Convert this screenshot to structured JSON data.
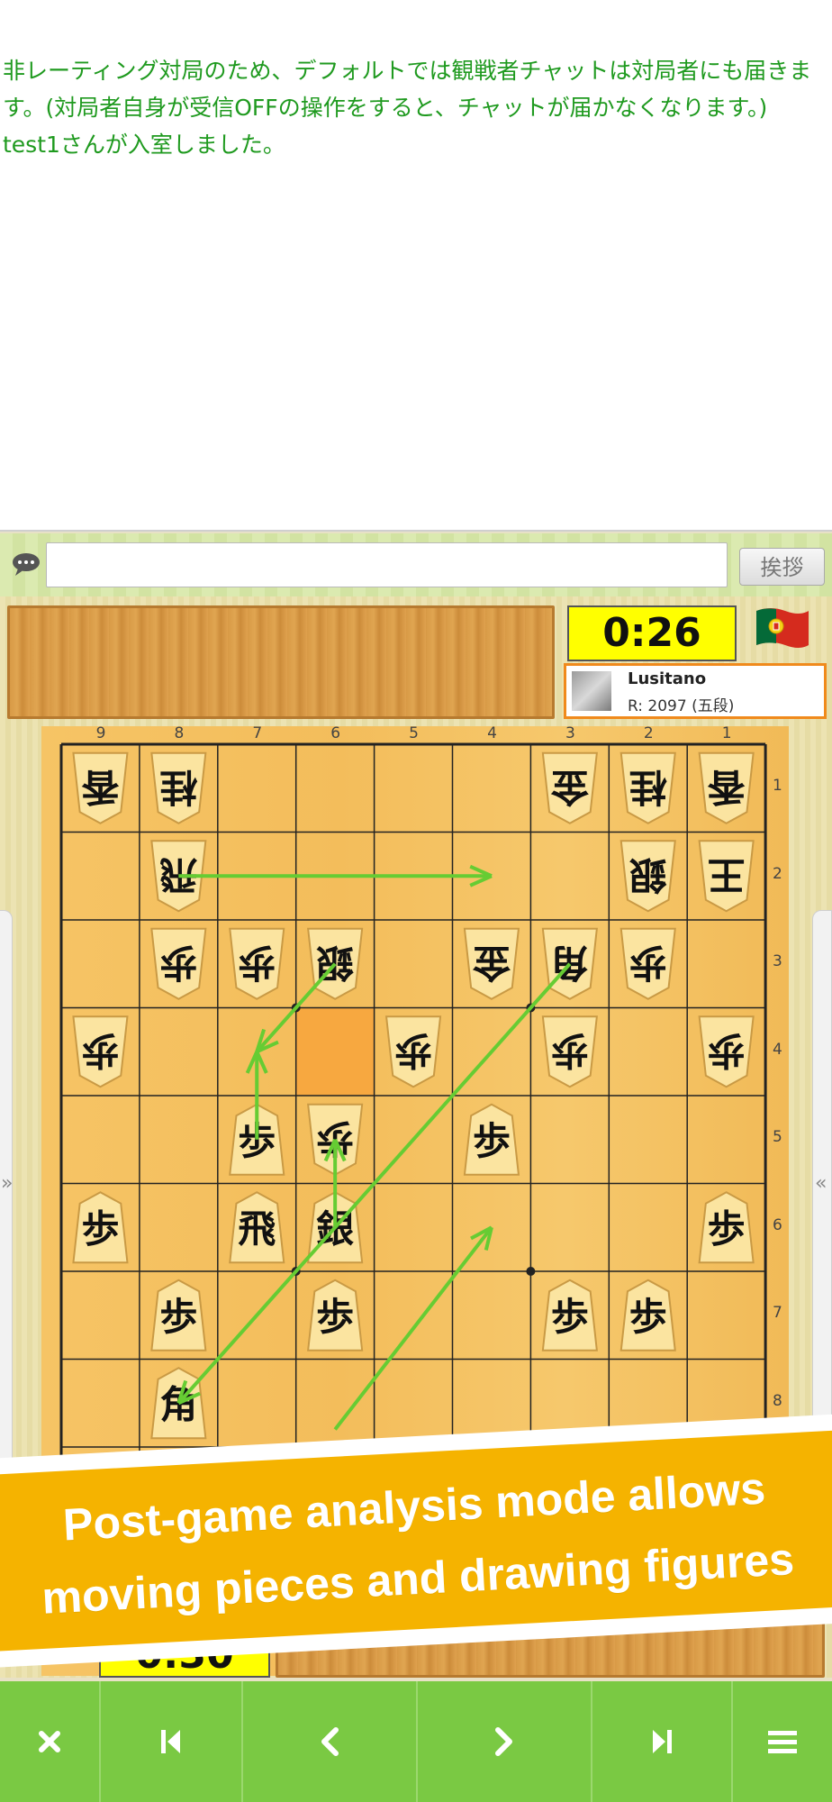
{
  "chat": {
    "messages": [
      "非レーティング対局のため、デフォルトでは観戦者チャットは対局者にも届きます。(対局者自身が受信OFFの操作をすると、チャットが届かなくなります。)",
      "test1さんが入室しました。"
    ],
    "input_value": "",
    "greet_label": "挨拶"
  },
  "opponent": {
    "clock": "0:26",
    "name": "Lusitano",
    "rating": "R: 2097 (五段)",
    "flag": "portugal-flag"
  },
  "self_clock": "0:30",
  "board": {
    "files": [
      "9",
      "8",
      "7",
      "6",
      "5",
      "4",
      "3",
      "2",
      "1"
    ],
    "ranks": [
      "1",
      "2",
      "3",
      "4",
      "5",
      "6",
      "7",
      "8",
      "9"
    ],
    "pieces": [
      {
        "c": "香",
        "f": 9,
        "r": 1,
        "g": true
      },
      {
        "c": "桂",
        "f": 8,
        "r": 1,
        "g": true
      },
      {
        "c": "金",
        "f": 3,
        "r": 1,
        "g": true
      },
      {
        "c": "桂",
        "f": 2,
        "r": 1,
        "g": true
      },
      {
        "c": "香",
        "f": 1,
        "r": 1,
        "g": true
      },
      {
        "c": "飛",
        "f": 8,
        "r": 2,
        "g": true
      },
      {
        "c": "銀",
        "f": 2,
        "r": 2,
        "g": true
      },
      {
        "c": "王",
        "f": 1,
        "r": 2,
        "g": true
      },
      {
        "c": "歩",
        "f": 8,
        "r": 3,
        "g": true
      },
      {
        "c": "歩",
        "f": 7,
        "r": 3,
        "g": true
      },
      {
        "c": "銀",
        "f": 6,
        "r": 3,
        "g": true
      },
      {
        "c": "金",
        "f": 4,
        "r": 3,
        "g": true
      },
      {
        "c": "角",
        "f": 3,
        "r": 3,
        "g": true
      },
      {
        "c": "歩",
        "f": 2,
        "r": 3,
        "g": true
      },
      {
        "c": "歩",
        "f": 9,
        "r": 4,
        "g": true
      },
      {
        "c": "歩",
        "f": 5,
        "r": 4,
        "g": true
      },
      {
        "c": "歩",
        "f": 3,
        "r": 4,
        "g": true
      },
      {
        "c": "歩",
        "f": 1,
        "r": 4,
        "g": true
      },
      {
        "c": "歩",
        "f": 7,
        "r": 5,
        "g": false
      },
      {
        "c": "歩",
        "f": 6,
        "r": 5,
        "g": true
      },
      {
        "c": "歩",
        "f": 4,
        "r": 5,
        "g": false
      },
      {
        "c": "歩",
        "f": 9,
        "r": 6,
        "g": false
      },
      {
        "c": "飛",
        "f": 7,
        "r": 6,
        "g": false
      },
      {
        "c": "銀",
        "f": 6,
        "r": 6,
        "g": false
      },
      {
        "c": "歩",
        "f": 1,
        "r": 6,
        "g": false
      },
      {
        "c": "歩",
        "f": 8,
        "r": 7,
        "g": false
      },
      {
        "c": "歩",
        "f": 6,
        "r": 7,
        "g": false
      },
      {
        "c": "歩",
        "f": 3,
        "r": 7,
        "g": false
      },
      {
        "c": "歩",
        "f": 2,
        "r": 7,
        "g": false
      },
      {
        "c": "角",
        "f": 8,
        "r": 8,
        "g": false
      }
    ],
    "highlight": {
      "f": 6,
      "r": 4
    },
    "arrows": [
      {
        "from": [
          8,
          2
        ],
        "to": [
          4,
          2
        ]
      },
      {
        "from": [
          6,
          3
        ],
        "to": [
          7,
          4
        ]
      },
      {
        "from": [
          7,
          5
        ],
        "to": [
          7,
          4
        ]
      },
      {
        "from": [
          6,
          6
        ],
        "to": [
          6,
          5
        ]
      },
      {
        "from": [
          3,
          3
        ],
        "to": [
          8,
          8
        ]
      },
      {
        "from": [
          6,
          8.3
        ],
        "to": [
          4,
          6
        ]
      }
    ]
  },
  "banner": {
    "line1": "Post-game analysis mode allows",
    "line2": "moving pieces and drawing figures"
  },
  "toolbar": {
    "buttons": [
      "close-icon",
      "first-move-icon",
      "prev-move-icon",
      "next-move-icon",
      "last-move-icon",
      "menu-icon"
    ]
  },
  "colors": {
    "accent_green": "#7ac943",
    "chat_text": "#1f9a1f",
    "banner": "#f5b300",
    "clock_bg": "#ffff00",
    "player_border": "#f08a1c",
    "arrow": "#66cc33"
  }
}
